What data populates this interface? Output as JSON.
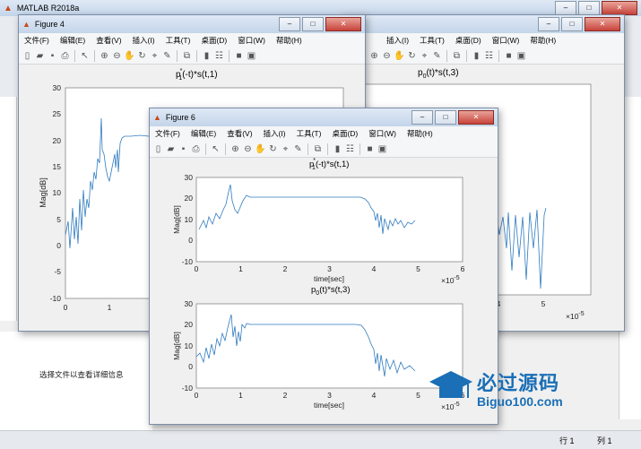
{
  "app": {
    "title": "MATLAB R2018a"
  },
  "figure4": {
    "title": "Figure 4",
    "menu": [
      "文件(F)",
      "编辑(E)",
      "查看(V)",
      "插入(I)",
      "工具(T)",
      "桌面(D)",
      "窗口(W)",
      "帮助(H)"
    ],
    "plot_title_base": "p",
    "plot_title_sup": "*",
    "plot_title_sub": "1",
    "plot_title_rest": "(-t)*s(t,1)",
    "ylabel": "Mag[dB]",
    "yticks": [
      "30",
      "25",
      "20",
      "15",
      "10",
      "5",
      "0",
      "-5",
      "-10"
    ],
    "xticks": [
      "0",
      "1"
    ]
  },
  "figure_back": {
    "menu": [
      "插入(I)",
      "工具(T)",
      "桌面(D)",
      "窗口(W)",
      "帮助(H)"
    ],
    "plot_title_base": "p",
    "plot_title_sub": "0",
    "plot_title_rest": "(t)*s(t,3)",
    "xticks": [
      "4",
      "5"
    ],
    "xexp": "×10",
    "xexp_power": "-5"
  },
  "figure6": {
    "title": "Figure 6",
    "menu": [
      "文件(F)",
      "编辑(E)",
      "查看(V)",
      "插入(I)",
      "工具(T)",
      "桌面(D)",
      "窗口(W)",
      "帮助(H)"
    ],
    "plot1": {
      "title_base": "p",
      "title_sup": "*",
      "title_sub": "1",
      "title_rest": "(-t)*s(t,1)",
      "ylabel": "Mag[dB]",
      "xlabel": "time[sec]",
      "yticks": [
        "30",
        "20",
        "10",
        "0",
        "-10"
      ],
      "xticks": [
        "0",
        "1",
        "2",
        "3",
        "4",
        "5",
        "6"
      ],
      "xexp": "×10",
      "xexp_power": "-5"
    },
    "plot2": {
      "title_base": "p",
      "title_sub": "0",
      "title_rest": "(t)*s(t,3)",
      "ylabel": "Mag[dB]",
      "xlabel": "time[sec]",
      "yticks": [
        "30",
        "20",
        "10",
        "0",
        "-10"
      ],
      "xticks": [
        "0",
        "1",
        "2",
        "3",
        "4",
        "5",
        "6"
      ],
      "xexp": "×10",
      "xexp_power": "-5"
    }
  },
  "background": {
    "detail_hint": "选择文件以查看详细信息",
    "status_row": "行 1",
    "status_col": "列 1"
  },
  "watermark": {
    "cn": "必过源码",
    "url": "Biguo100.com"
  },
  "colors": {
    "line": "#2f7bbf",
    "accent": "#1a6fb6"
  }
}
